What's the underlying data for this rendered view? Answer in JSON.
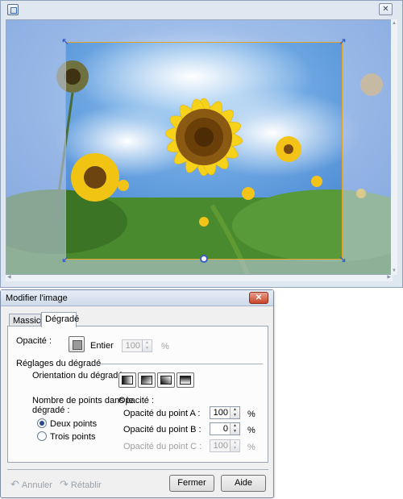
{
  "editor": {
    "window_icon": "app-window-icon",
    "close_icon": "close-icon"
  },
  "dialog": {
    "title": "Modifier l'image",
    "tabs": [
      {
        "label": "Massicot"
      },
      {
        "label": "Dégradé"
      }
    ],
    "opacity": {
      "label": "Opacité :",
      "mode_label": "Entier",
      "value": "100",
      "unit": "%"
    },
    "gradient_settings": {
      "section_label": "Réglages du dégradé",
      "orientation_label": "Orientation du dégradé :",
      "points_label_line1": "Nombre de points dans le",
      "points_label_line2": "dégradé :",
      "option_two": "Deux points",
      "option_three": "Trois points",
      "opacity_header": "Opacité :",
      "point_a": {
        "label": "Opacité du point A :",
        "value": "100",
        "unit": "%"
      },
      "point_b": {
        "label": "Opacité du point B :",
        "value": "0",
        "unit": "%"
      },
      "point_c": {
        "label": "Opacité du point C :",
        "value": "100",
        "unit": "%"
      }
    },
    "footer": {
      "undo_label": "Annuler",
      "redo_label": "Rétablir",
      "close_label": "Fermer",
      "help_label": "Aide"
    },
    "close_x": "✕"
  }
}
